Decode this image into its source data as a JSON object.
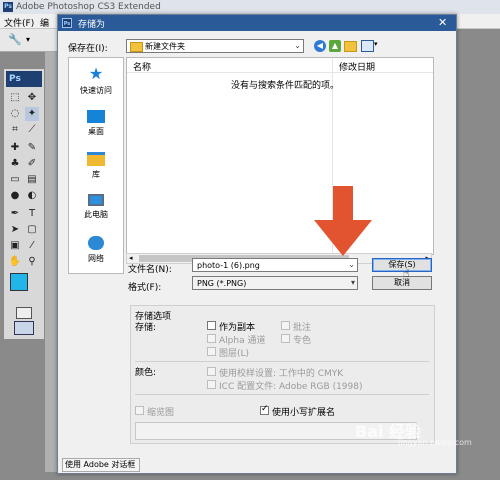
{
  "app": {
    "logo_text": "Ps",
    "title": "Adobe Photoshop CS3 Extended",
    "menu": [
      "文件(F)",
      "编"
    ]
  },
  "toolbox": {
    "logo": "Ps"
  },
  "dialog": {
    "title": "存储为",
    "save_in_label": "保存在(I):",
    "save_in_value": "新建文件夹",
    "places": [
      "快速访问",
      "桌面",
      "库",
      "此电脑",
      "网络"
    ],
    "columns": {
      "name": "名称",
      "modified": "修改日期"
    },
    "empty_message": "没有与搜索条件匹配的项。",
    "filename_label": "文件名(N):",
    "filename_value": "photo-1 (6).png",
    "format_label": "格式(F):",
    "format_value": "PNG (*.PNG)",
    "save_button": "保存(S)",
    "cancel_button": "取消",
    "options": {
      "section_title": "存储选项",
      "save_label": "存储:",
      "as_copy": "作为副本",
      "annotations": "批注",
      "alpha": "Alpha 通道",
      "spot": "专色",
      "layers": "图层(L)",
      "color_label": "颜色:",
      "proof_setup": "使用校样设置: 工作中的 CMYK",
      "icc_profile": "ICC 配置文件: Adobe RGB (1998)",
      "thumbnail": "缩览图",
      "lowercase_ext": "使用小写扩展名"
    },
    "use_adobe_dialog": "使用 Adobe 对话框"
  },
  "watermark": {
    "brand": "Bai 经验",
    "url": "jingyan.baidu.com"
  },
  "colors": {
    "titlebar": "#2b5a98",
    "arrow": "#e2542f",
    "swatch": "#22b5ea"
  }
}
